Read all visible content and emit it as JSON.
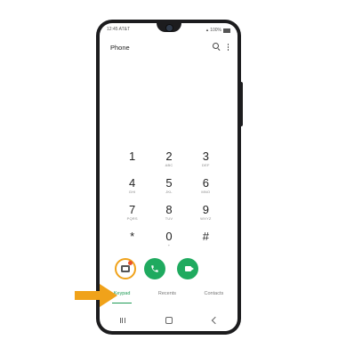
{
  "status_bar": {
    "time_carrier": "12:45 AT&T",
    "battery": "100%"
  },
  "header": {
    "title": "Phone",
    "icons": [
      "search-icon",
      "more-options-icon"
    ]
  },
  "keypad": [
    {
      "digit": "1",
      "letters": ""
    },
    {
      "digit": "2",
      "letters": "ABC"
    },
    {
      "digit": "3",
      "letters": "DEF"
    },
    {
      "digit": "4",
      "letters": "GHI"
    },
    {
      "digit": "5",
      "letters": "JKL"
    },
    {
      "digit": "6",
      "letters": "MNO"
    },
    {
      "digit": "7",
      "letters": "PQRS"
    },
    {
      "digit": "8",
      "letters": "TUV"
    },
    {
      "digit": "9",
      "letters": "WXYZ"
    },
    {
      "digit": "*",
      "letters": ""
    },
    {
      "digit": "0",
      "letters": "+"
    },
    {
      "digit": "#",
      "letters": ""
    }
  ],
  "actions": {
    "icons": [
      "voicemail-icon",
      "phone-icon",
      "video-call-icon"
    ]
  },
  "tabs": [
    {
      "label": "Keypad",
      "active": true
    },
    {
      "label": "Recents",
      "active": false
    },
    {
      "label": "Contacts",
      "active": false
    }
  ],
  "colors": {
    "accent_green": "#1faa5f",
    "highlight_orange": "#f0a21a",
    "pointer_arrow": "#f0a21a"
  }
}
